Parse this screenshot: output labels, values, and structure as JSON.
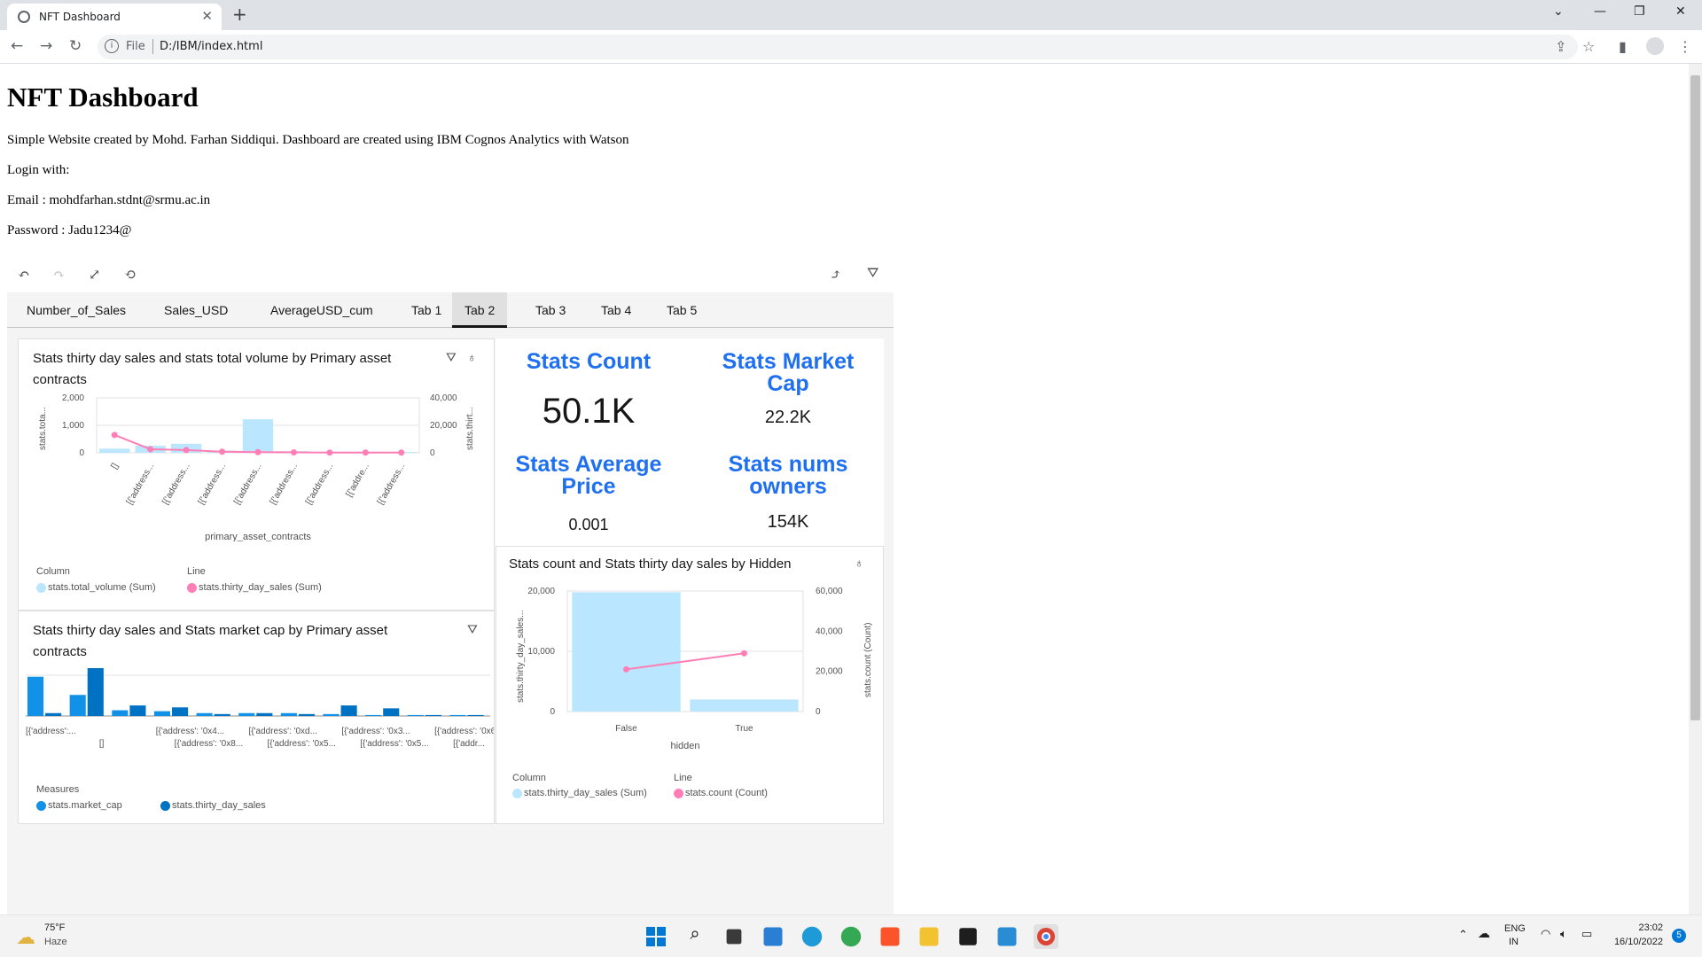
{
  "browser": {
    "tab_title": "NFT Dashboard",
    "address_scheme": "File",
    "address_url": "D:/IBM/index.html"
  },
  "page": {
    "heading": "NFT Dashboard",
    "lines": [
      "Simple Website created by Mohd. Farhan Siddiqui. Dashboard are created using IBM Cognos Analytics with Watson",
      "Login with:",
      "Email : mohdfarhan.stdnt@srmu.ac.in",
      "Password : Jadu1234@"
    ]
  },
  "dashboard": {
    "tabs": [
      "Number_of_Sales",
      "Sales_USD",
      "AverageUSD_cum",
      "Tab 1",
      "Tab 2",
      "Tab 3",
      "Tab 4",
      "Tab 5"
    ],
    "active_tab": "Tab 2",
    "kpis": [
      {
        "title": "Stats Count",
        "value": "50.1K"
      },
      {
        "title": "Stats Market Cap",
        "value": "22.2K"
      },
      {
        "title": "Stats Average Price",
        "value": "0.001"
      },
      {
        "title": "Stats nums owners",
        "value": "154K"
      }
    ],
    "colors": {
      "light_bar": "#bae6ff",
      "line": "#ff7eb6",
      "dark_bar": "#0072c3",
      "mid_bar": "#1192e8",
      "kpi_title": "#1f70f0"
    }
  },
  "chart_data": [
    {
      "type": "bar",
      "title": "Stats thirty day sales and stats total volume by Primary asset contracts",
      "xlabel": "primary_asset_contracts",
      "ylabel_left": "stats.tota...",
      "ylabel_right": "stats.thirt...",
      "categories": [
        "[]",
        "[{'address...",
        "[{'address...",
        "[{'address...",
        "[{'address...",
        "[{'address...",
        "[{'address...",
        "[{'addre...",
        "[{'address..."
      ],
      "ylim_left": [
        0,
        2000
      ],
      "ylim_right": [
        0,
        40000
      ],
      "left_ticks": [
        "2,000",
        "1,000",
        "0"
      ],
      "right_ticks": [
        "40,000",
        "20,000",
        "0"
      ],
      "legend_column_header": "Column",
      "legend_line_header": "Line",
      "series": [
        {
          "name": "stats.total_volume (Sum)",
          "kind": "column",
          "axis": "left",
          "values": [
            150,
            260,
            330,
            80,
            1220,
            60,
            40,
            40,
            30
          ]
        },
        {
          "name": "stats.thirty_day_sales (Sum)",
          "kind": "line",
          "axis": "right",
          "values": [
            13000,
            2600,
            2000,
            800,
            500,
            300,
            200,
            200,
            150
          ]
        }
      ]
    },
    {
      "type": "bar",
      "title": "Stats thirty day sales and Stats market cap by Primary asset contracts",
      "legend_header": "Measures",
      "categories_row1": [
        "[{'address':...",
        "[{'address': '0x4...",
        "[{'address': '0xd...",
        "[{'address': '0x3...",
        "[{'address': '0x6..."
      ],
      "categories_row2": [
        "[]",
        "[{'address': '0x8...",
        "[{'address': '0x5...",
        "[{'address': '0x5...",
        "[{'addr..."
      ],
      "series": [
        {
          "name": "stats.market_cap",
          "values": [
            0.82,
            0.44,
            0.12,
            0.1,
            0.06,
            0.06,
            0.06,
            0.04,
            0.02,
            0.02,
            0.02
          ]
        },
        {
          "name": "stats.thirty_day_sales",
          "values": [
            0.06,
            1.0,
            0.22,
            0.18,
            0.04,
            0.06,
            0.04,
            0.22,
            0.16,
            0.02,
            0.02
          ]
        }
      ]
    },
    {
      "type": "bar",
      "title": "Stats count and Stats thirty day sales by Hidden",
      "xlabel": "hidden",
      "ylabel_left": "stats.thirty_day_sales...",
      "ylabel_right": "stats.count (Count)",
      "categories": [
        "False",
        "True"
      ],
      "ylim_left": [
        0,
        20000
      ],
      "ylim_right": [
        0,
        60000
      ],
      "left_ticks": [
        "20,000",
        "10,000",
        "0"
      ],
      "right_ticks": [
        "60,000",
        "40,000",
        "20,000",
        "0"
      ],
      "legend_column_header": "Column",
      "legend_line_header": "Line",
      "series": [
        {
          "name": "stats.thirty_day_sales (Sum)",
          "kind": "column",
          "axis": "left",
          "values": [
            19800,
            2000
          ]
        },
        {
          "name": "stats.count (Count)",
          "kind": "line",
          "axis": "right",
          "values": [
            21000,
            29000
          ]
        }
      ]
    }
  ],
  "taskbar": {
    "weather_temp": "75°F",
    "weather_desc": "Haze",
    "lang_line1": "ENG",
    "lang_line2": "IN",
    "time": "23:02",
    "date": "16/10/2022",
    "notif_count": "5"
  }
}
